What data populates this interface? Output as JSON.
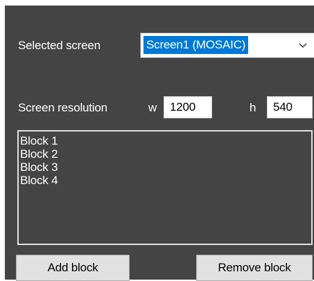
{
  "screen_select": {
    "label": "Selected screen",
    "value": "Screen1 (MOSAIC)"
  },
  "resolution": {
    "label": "Screen resolution",
    "width_label": "w",
    "width_value": "1200",
    "height_label": "h",
    "height_value": "540"
  },
  "blocks": {
    "items": [
      "Block 1",
      "Block 2",
      "Block 3",
      "Block 4"
    ]
  },
  "buttons": {
    "add_label": "Add block",
    "remove_label": "Remove block"
  },
  "colors": {
    "panel_bg": "#444444",
    "selection": "#0078d7",
    "button_bg": "#e1e1e1"
  },
  "icons": {
    "dropdown": "chevron-down-icon"
  }
}
